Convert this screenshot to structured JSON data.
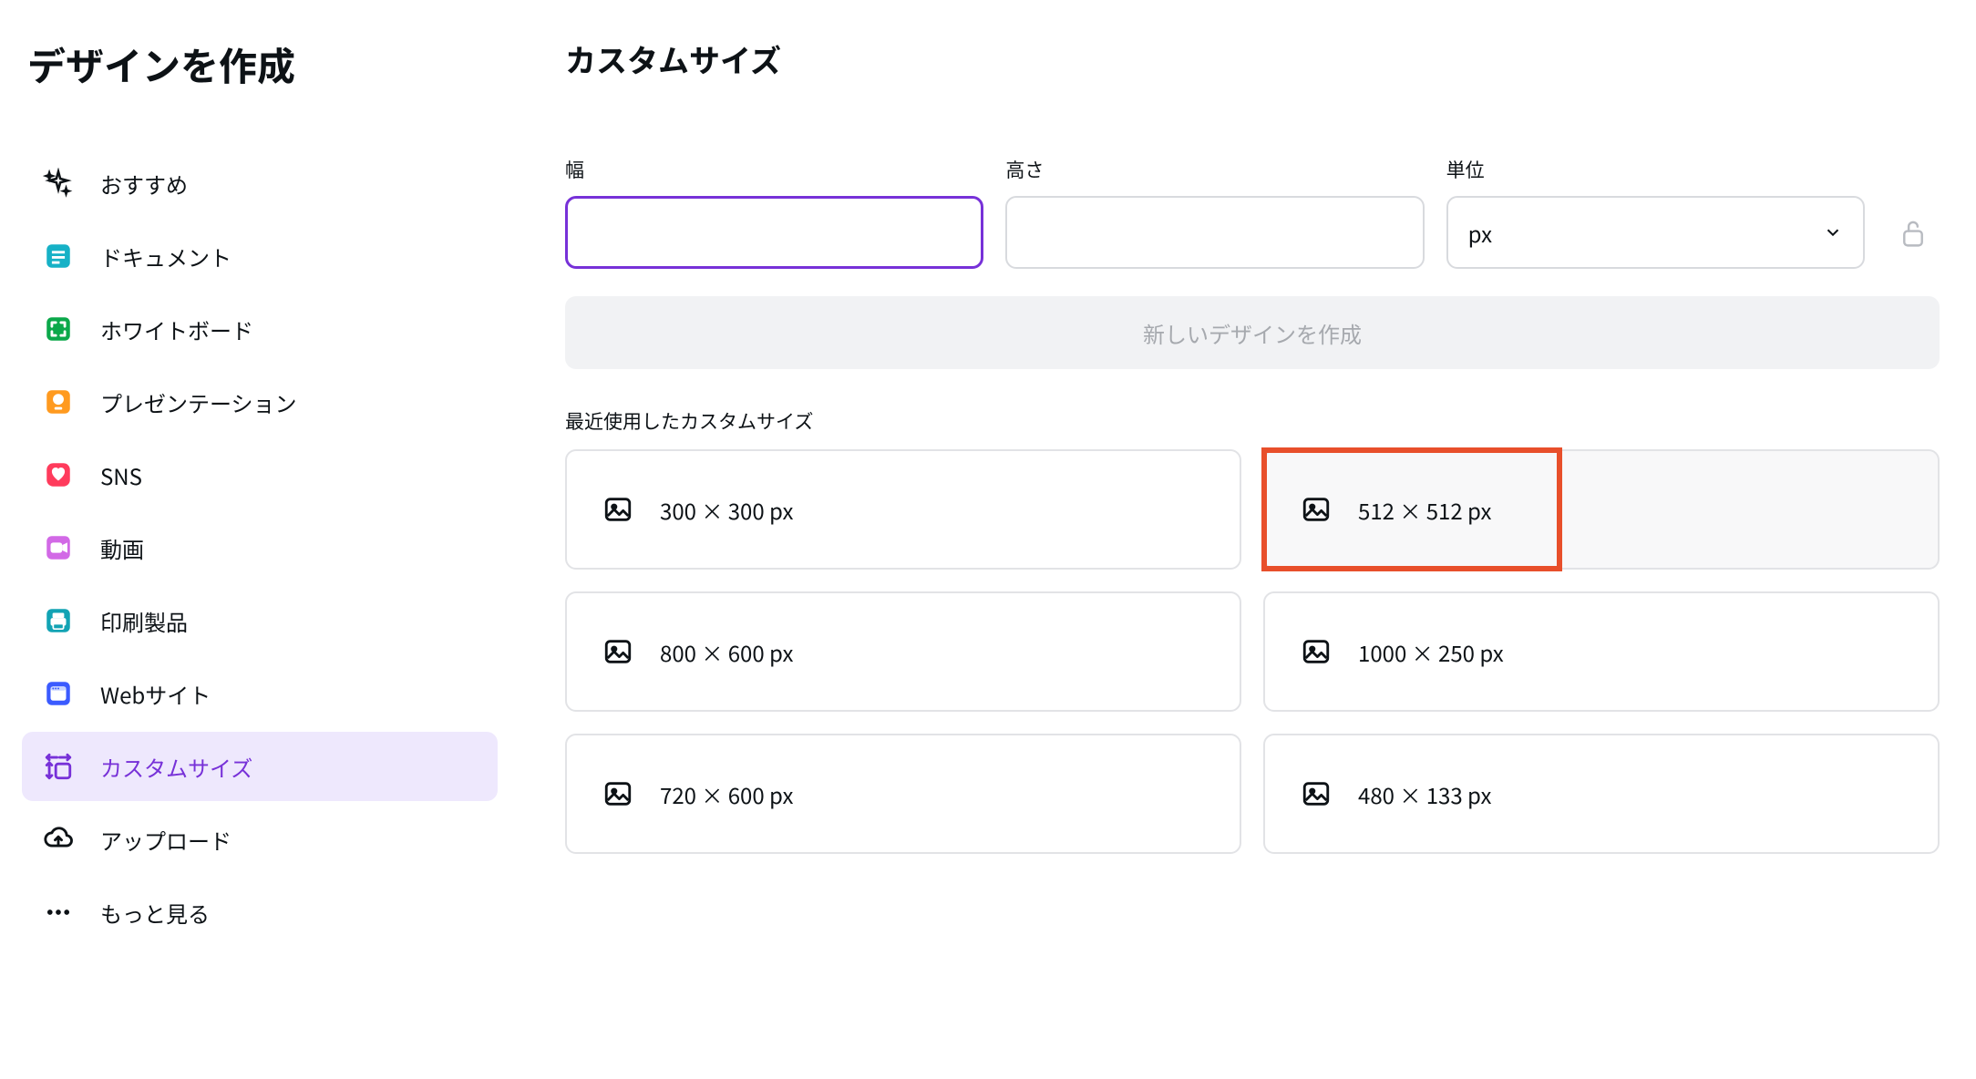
{
  "sidebar": {
    "title": "デザインを作成",
    "items": [
      {
        "key": "recommended",
        "label": "おすすめ",
        "icon": "sparkle"
      },
      {
        "key": "documents",
        "label": "ドキュメント",
        "icon": "doc"
      },
      {
        "key": "whiteboard",
        "label": "ホワイトボード",
        "icon": "whiteboard"
      },
      {
        "key": "presentation",
        "label": "プレゼンテーション",
        "icon": "presentation"
      },
      {
        "key": "sns",
        "label": "SNS",
        "icon": "sns"
      },
      {
        "key": "video",
        "label": "動画",
        "icon": "video"
      },
      {
        "key": "print",
        "label": "印刷製品",
        "icon": "print"
      },
      {
        "key": "website",
        "label": "Webサイト",
        "icon": "website"
      },
      {
        "key": "custom-size",
        "label": "カスタムサイズ",
        "icon": "custom-size",
        "selected": true
      },
      {
        "key": "upload",
        "label": "アップロード",
        "icon": "upload"
      },
      {
        "key": "more",
        "label": "もっと見る",
        "icon": "more"
      }
    ]
  },
  "main": {
    "title": "カスタムサイズ",
    "width_label": "幅",
    "height_label": "高さ",
    "unit_label": "単位",
    "unit_value": "px",
    "create_label": "新しいデザインを作成",
    "recent_label": "最近使用したカスタムサイズ",
    "recent": [
      {
        "label": "300 × 300 px"
      },
      {
        "label": "512 × 512 px",
        "hovered": true,
        "highlighted": true
      },
      {
        "label": "800 × 600 px"
      },
      {
        "label": "1000 × 250 px"
      },
      {
        "label": "720 × 600 px"
      },
      {
        "label": "480 × 133 px"
      }
    ]
  }
}
